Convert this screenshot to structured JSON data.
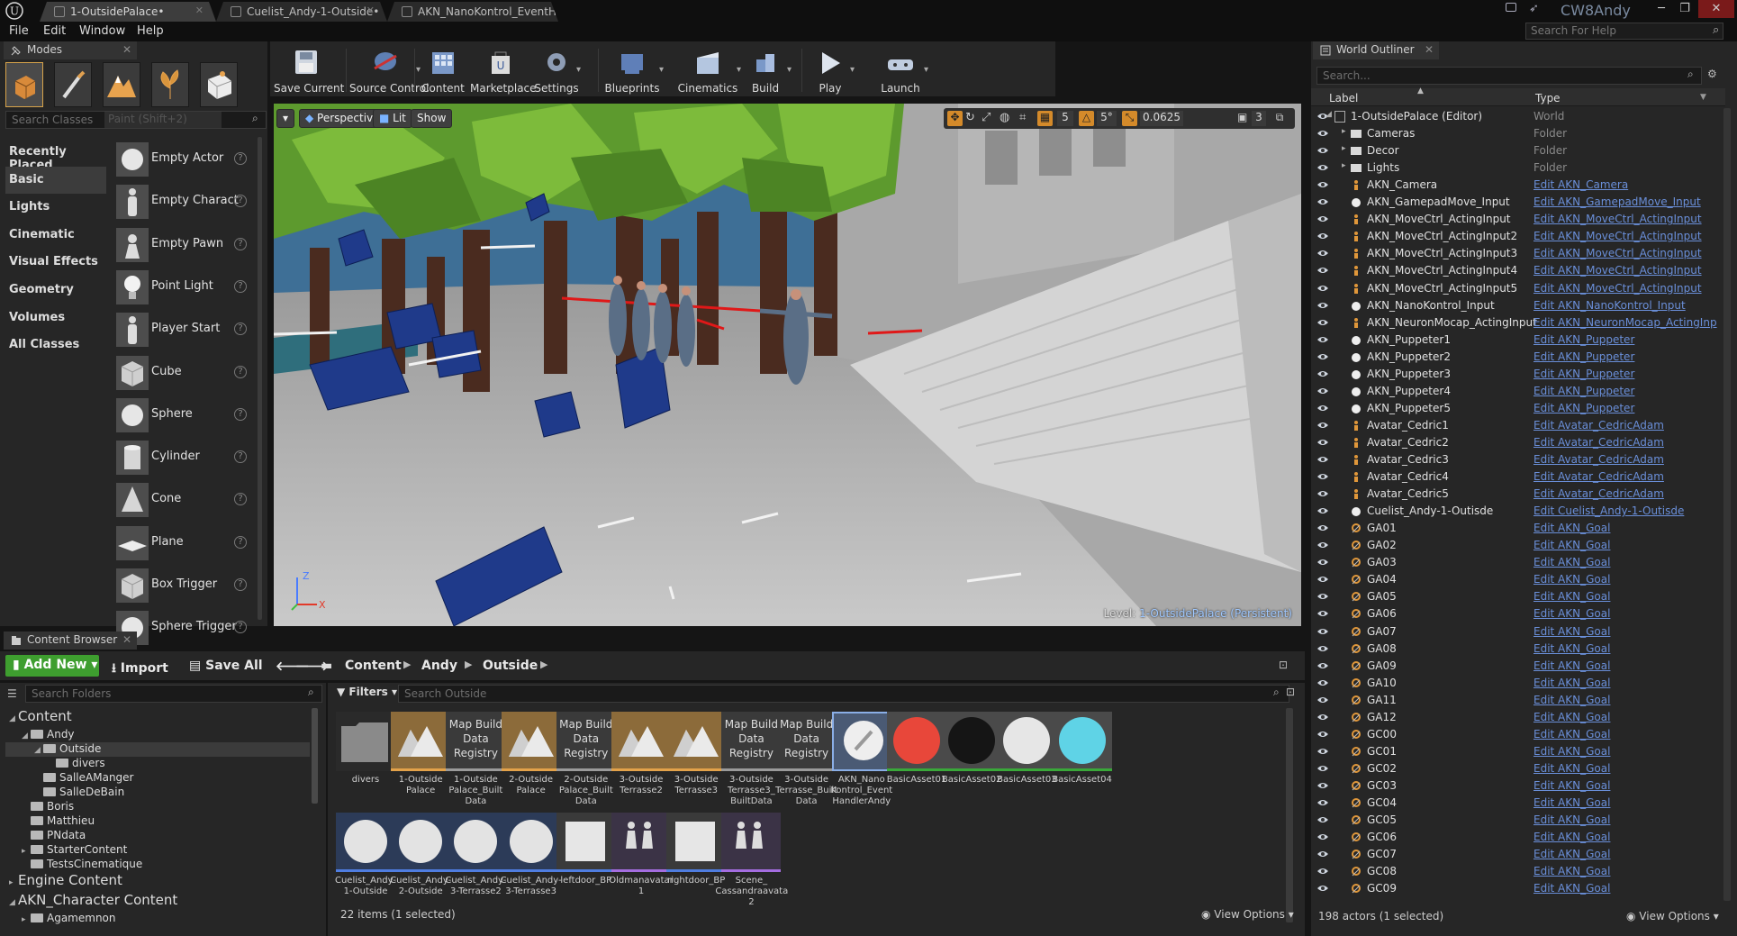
{
  "window": {
    "tabs": [
      "1-OutsidePalace•",
      "Cuelist_Andy-1-Outside•",
      "AKN_NanoKontrol_EventH"
    ],
    "user": "CW8Andy",
    "help_search_placeholder": "Search For Help",
    "menu": [
      "File",
      "Edit",
      "Window",
      "Help"
    ]
  },
  "modes": {
    "title": "Modes",
    "search_placeholder": "Search Classes",
    "paint_hint": "Paint (Shift+2)",
    "categories": [
      "Recently Placed",
      "Basic",
      "Lights",
      "Cinematic",
      "Visual Effects",
      "Geometry",
      "Volumes",
      "All Classes"
    ],
    "active_category": "Basic",
    "items": [
      "Empty Actor",
      "Empty Charact",
      "Empty Pawn",
      "Point Light",
      "Player Start",
      "Cube",
      "Sphere",
      "Cylinder",
      "Cone",
      "Plane",
      "Box Trigger",
      "Sphere Trigger"
    ]
  },
  "toolbar": {
    "buttons": [
      "Save Current",
      "Source Control",
      "Content",
      "Marketplace",
      "Settings",
      "Blueprints",
      "Cinematics",
      "Build",
      "Play",
      "Launch"
    ]
  },
  "viewport": {
    "perspective": "Perspective",
    "lit": "Lit",
    "show": "Show",
    "grid_snap": "5",
    "rot_snap": "5°",
    "scale_snap": "0.0625",
    "cam_speed": "3",
    "level_prefix": "Level:",
    "level_name": "1-OutsidePalace (Persistent)",
    "axis_z": "Z",
    "axis_x": "X"
  },
  "outliner": {
    "title": "World Outliner",
    "search_placeholder": "Search...",
    "col_label": "Label",
    "col_type": "Type",
    "status": "198 actors (1 selected)",
    "view_options": "View Options",
    "rows": [
      {
        "label": "1-OutsidePalace (Editor)",
        "type": "World",
        "indent": 0,
        "kind": "world"
      },
      {
        "label": "Cameras",
        "type": "Folder",
        "indent": 1,
        "kind": "folder"
      },
      {
        "label": "Decor",
        "type": "Folder",
        "indent": 1,
        "kind": "folder"
      },
      {
        "label": "Lights",
        "type": "Folder",
        "indent": 1,
        "kind": "folder"
      },
      {
        "label": "AKN_Camera",
        "type": "Edit AKN_Camera",
        "indent": 1,
        "kind": "bp"
      },
      {
        "label": "AKN_GamepadMove_Input",
        "type": "Edit AKN_GamepadMove_Input",
        "indent": 1,
        "kind": "ball"
      },
      {
        "label": "AKN_MoveCtrl_ActingInput",
        "type": "Edit AKN_MoveCtrl_ActingInput",
        "indent": 1,
        "kind": "bp"
      },
      {
        "label": "AKN_MoveCtrl_ActingInput2",
        "type": "Edit AKN_MoveCtrl_ActingInput",
        "indent": 1,
        "kind": "bp"
      },
      {
        "label": "AKN_MoveCtrl_ActingInput3",
        "type": "Edit AKN_MoveCtrl_ActingInput",
        "indent": 1,
        "kind": "bp"
      },
      {
        "label": "AKN_MoveCtrl_ActingInput4",
        "type": "Edit AKN_MoveCtrl_ActingInput",
        "indent": 1,
        "kind": "bp"
      },
      {
        "label": "AKN_MoveCtrl_ActingInput5",
        "type": "Edit AKN_MoveCtrl_ActingInput",
        "indent": 1,
        "kind": "bp"
      },
      {
        "label": "AKN_NanoKontrol_Input",
        "type": "Edit AKN_NanoKontrol_Input",
        "indent": 1,
        "kind": "ball"
      },
      {
        "label": "AKN_NeuronMocap_ActingInput",
        "type": "Edit AKN_NeuronMocap_ActingInp",
        "indent": 1,
        "kind": "bp"
      },
      {
        "label": "AKN_Puppeter1",
        "type": "Edit AKN_Puppeter",
        "indent": 1,
        "kind": "ball"
      },
      {
        "label": "AKN_Puppeter2",
        "type": "Edit AKN_Puppeter",
        "indent": 1,
        "kind": "ball"
      },
      {
        "label": "AKN_Puppeter3",
        "type": "Edit AKN_Puppeter",
        "indent": 1,
        "kind": "ball"
      },
      {
        "label": "AKN_Puppeter4",
        "type": "Edit AKN_Puppeter",
        "indent": 1,
        "kind": "ball"
      },
      {
        "label": "AKN_Puppeter5",
        "type": "Edit AKN_Puppeter",
        "indent": 1,
        "kind": "ball"
      },
      {
        "label": "Avatar_Cedric1",
        "type": "Edit Avatar_CedricAdam",
        "indent": 1,
        "kind": "bp"
      },
      {
        "label": "Avatar_Cedric2",
        "type": "Edit Avatar_CedricAdam",
        "indent": 1,
        "kind": "bp"
      },
      {
        "label": "Avatar_Cedric3",
        "type": "Edit Avatar_CedricAdam",
        "indent": 1,
        "kind": "bp"
      },
      {
        "label": "Avatar_Cedric4",
        "type": "Edit Avatar_CedricAdam",
        "indent": 1,
        "kind": "bp"
      },
      {
        "label": "Avatar_Cedric5",
        "type": "Edit Avatar_CedricAdam",
        "indent": 1,
        "kind": "bp"
      },
      {
        "label": "Cuelist_Andy-1-Outisde",
        "type": "Edit Cuelist_Andy-1-Outisde",
        "indent": 1,
        "kind": "ball"
      },
      {
        "label": "GA01",
        "type": "Edit AKN_Goal",
        "indent": 1,
        "kind": "goal"
      },
      {
        "label": "GA02",
        "type": "Edit AKN_Goal",
        "indent": 1,
        "kind": "goal"
      },
      {
        "label": "GA03",
        "type": "Edit AKN_Goal",
        "indent": 1,
        "kind": "goal"
      },
      {
        "label": "GA04",
        "type": "Edit AKN_Goal",
        "indent": 1,
        "kind": "goal"
      },
      {
        "label": "GA05",
        "type": "Edit AKN_Goal",
        "indent": 1,
        "kind": "goal"
      },
      {
        "label": "GA06",
        "type": "Edit AKN_Goal",
        "indent": 1,
        "kind": "goal"
      },
      {
        "label": "GA07",
        "type": "Edit AKN_Goal",
        "indent": 1,
        "kind": "goal"
      },
      {
        "label": "GA08",
        "type": "Edit AKN_Goal",
        "indent": 1,
        "kind": "goal"
      },
      {
        "label": "GA09",
        "type": "Edit AKN_Goal",
        "indent": 1,
        "kind": "goal"
      },
      {
        "label": "GA10",
        "type": "Edit AKN_Goal",
        "indent": 1,
        "kind": "goal"
      },
      {
        "label": "GA11",
        "type": "Edit AKN_Goal",
        "indent": 1,
        "kind": "goal"
      },
      {
        "label": "GA12",
        "type": "Edit AKN_Goal",
        "indent": 1,
        "kind": "goal"
      },
      {
        "label": "GC00",
        "type": "Edit AKN_Goal",
        "indent": 1,
        "kind": "goal"
      },
      {
        "label": "GC01",
        "type": "Edit AKN_Goal",
        "indent": 1,
        "kind": "goal"
      },
      {
        "label": "GC02",
        "type": "Edit AKN_Goal",
        "indent": 1,
        "kind": "goal"
      },
      {
        "label": "GC03",
        "type": "Edit AKN_Goal",
        "indent": 1,
        "kind": "goal"
      },
      {
        "label": "GC04",
        "type": "Edit AKN_Goal",
        "indent": 1,
        "kind": "goal"
      },
      {
        "label": "GC05",
        "type": "Edit AKN_Goal",
        "indent": 1,
        "kind": "goal"
      },
      {
        "label": "GC06",
        "type": "Edit AKN_Goal",
        "indent": 1,
        "kind": "goal"
      },
      {
        "label": "GC07",
        "type": "Edit AKN_Goal",
        "indent": 1,
        "kind": "goal"
      },
      {
        "label": "GC08",
        "type": "Edit AKN_Goal",
        "indent": 1,
        "kind": "goal"
      },
      {
        "label": "GC09",
        "type": "Edit AKN_Goal",
        "indent": 1,
        "kind": "goal"
      }
    ]
  },
  "content_browser": {
    "title": "Content Browser",
    "add_new": "Add New",
    "import": "Import",
    "save_all": "Save All",
    "breadcrumb": [
      "Content",
      "Andy",
      "Outside"
    ],
    "folder_search_placeholder": "Search Folders",
    "filters": "Filters",
    "asset_search_placeholder": "Search Outside",
    "status": "22 items (1 selected)",
    "view_options": "View Options",
    "tree": [
      {
        "label": "Content",
        "indent": 0,
        "big": true,
        "arrow": "◢"
      },
      {
        "label": "Andy",
        "indent": 1,
        "big": false,
        "arrow": "◢"
      },
      {
        "label": "Outside",
        "indent": 2,
        "big": false,
        "arrow": "◢",
        "selected": true
      },
      {
        "label": "divers",
        "indent": 3,
        "big": false,
        "arrow": ""
      },
      {
        "label": "SalleAManger",
        "indent": 2,
        "big": false,
        "arrow": ""
      },
      {
        "label": "SalleDeBain",
        "indent": 2,
        "big": false,
        "arrow": ""
      },
      {
        "label": "Boris",
        "indent": 1,
        "big": false,
        "arrow": ""
      },
      {
        "label": "Matthieu",
        "indent": 1,
        "big": false,
        "arrow": ""
      },
      {
        "label": "PNdata",
        "indent": 1,
        "big": false,
        "arrow": ""
      },
      {
        "label": "StarterContent",
        "indent": 1,
        "big": false,
        "arrow": "▸"
      },
      {
        "label": "TestsCinematique",
        "indent": 1,
        "big": false,
        "arrow": ""
      },
      {
        "label": "Engine Content",
        "indent": 0,
        "big": true,
        "arrow": "▸"
      },
      {
        "label": "AKN_Character Content",
        "indent": 0,
        "big": true,
        "arrow": "◢"
      },
      {
        "label": "Agamemnon",
        "indent": 1,
        "big": false,
        "arrow": "▸"
      }
    ],
    "assets": [
      {
        "label": "divers",
        "kind": "folder"
      },
      {
        "label": "1-Outside Palace",
        "kind": "level"
      },
      {
        "label": "1-Outside Palace_Built Data",
        "kind": "registry",
        "mb": "Map Build Data Registry"
      },
      {
        "label": "2-Outside Palace",
        "kind": "level"
      },
      {
        "label": "2-Outside Palace_Built Data",
        "kind": "registry",
        "mb": "Map Build Data Registry"
      },
      {
        "label": "3-Outside Terrasse2",
        "kind": "level"
      },
      {
        "label": "3-Outside Terrasse3",
        "kind": "level"
      },
      {
        "label": "3-Outside Terrasse3_ BuiltData",
        "kind": "registry",
        "mb": "Map Build Data Registry"
      },
      {
        "label": "3-Outside Terrasse_Built Data",
        "kind": "registry",
        "mb": "Map Build Data Registry"
      },
      {
        "label": "AKN_Nano Kontrol_Event HandlerAndy",
        "kind": "nano"
      },
      {
        "label": "BasicAsset01",
        "kind": "ball",
        "color": "#e8473a"
      },
      {
        "label": "BasicAsset02",
        "kind": "ball",
        "color": "#151515"
      },
      {
        "label": "BasicAsset03",
        "kind": "ball",
        "color": "#e6e6e6"
      },
      {
        "label": "BasicAsset04",
        "kind": "ball",
        "color": "#5fd3e6"
      },
      {
        "label": "Cuelist_Andy- 1-Outside",
        "kind": "cue"
      },
      {
        "label": "Cuelist_Andy- 2-Outside",
        "kind": "cue"
      },
      {
        "label": "Cuelist_Andy- 3-Terrasse2",
        "kind": "cue"
      },
      {
        "label": "Cuelist_Andy- 3-Terrasse3",
        "kind": "cue"
      },
      {
        "label": "leftdoor_BP",
        "kind": "bp"
      },
      {
        "label": "Oldmanavatar 1",
        "kind": "anim"
      },
      {
        "label": "rightdoor_BP",
        "kind": "bp"
      },
      {
        "label": "Scene_ Cassandraavata 2",
        "kind": "anim"
      }
    ]
  }
}
